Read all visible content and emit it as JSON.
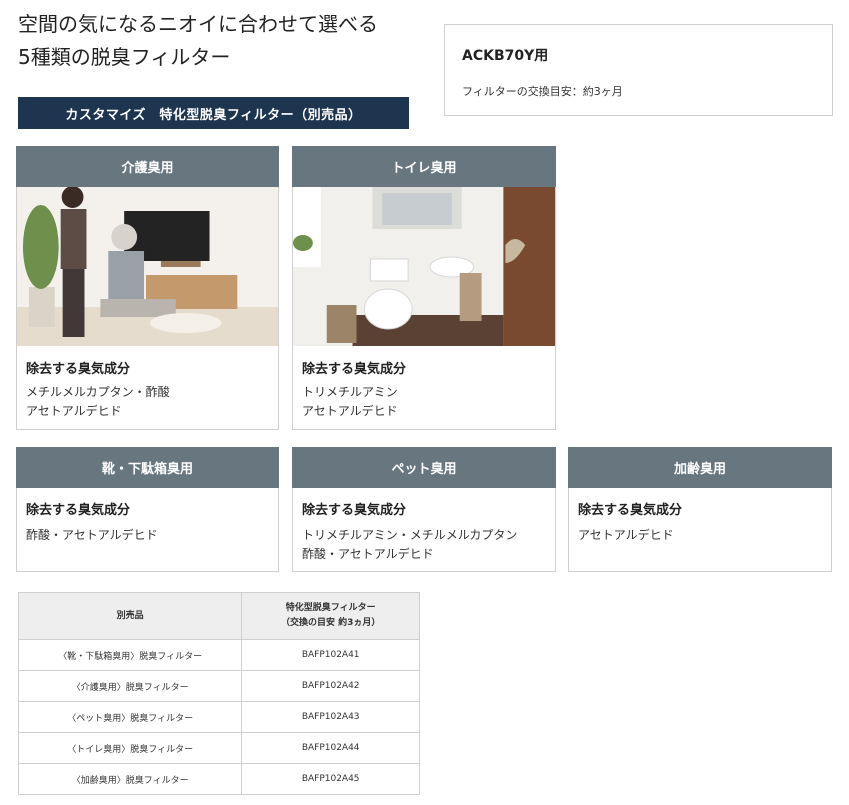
{
  "title": {
    "line1": "空間の気になるニオイに合わせて選べる",
    "line2": "5種類の脱臭フィルター"
  },
  "info": {
    "model": "ACKB70Y用",
    "note": "フィルターの交換目安：約3ヶ月"
  },
  "banner": "カスタマイズ　特化型脱臭フィルター（別売品）",
  "cards": [
    {
      "title": "介護臭用",
      "subtitle": "除去する臭気成分",
      "lines": [
        "メチルメルカプタン・酢酸",
        "アセトアルデヒド"
      ]
    },
    {
      "title": "トイレ臭用",
      "subtitle": "除去する臭気成分",
      "lines": [
        "トリメチルアミン",
        "アセトアルデヒド"
      ]
    },
    {
      "title": "靴・下駄箱臭用",
      "subtitle": "除去する臭気成分",
      "lines": [
        "酢酸・アセトアルデヒド"
      ]
    },
    {
      "title": "ペット臭用",
      "subtitle": "除去する臭気成分",
      "lines": [
        "トリメチルアミン・メチルメルカプタン",
        "酢酸・アセトアルデヒド"
      ]
    },
    {
      "title": "加齢臭用",
      "subtitle": "除去する臭気成分",
      "lines": [
        "アセトアルデヒド"
      ]
    }
  ],
  "table": {
    "headers": [
      "別売品",
      "特化型脱臭フィルター",
      "（交換の目安 約3ヵ月）"
    ],
    "rows": [
      [
        "〈靴・下駄箱臭用〉脱臭フィルター",
        "BAFP102A41"
      ],
      [
        "〈介護臭用〉脱臭フィルター",
        "BAFP102A42"
      ],
      [
        "〈ペット臭用〉脱臭フィルター",
        "BAFP102A43"
      ],
      [
        "〈トイレ臭用〉脱臭フィルター",
        "BAFP102A44"
      ],
      [
        "〈加齢臭用〉脱臭フィルター",
        "BAFP102A45"
      ]
    ]
  },
  "colors": {
    "card_header": "#67767f",
    "banner": "#1e3550",
    "table_header": "#eeeeee"
  }
}
